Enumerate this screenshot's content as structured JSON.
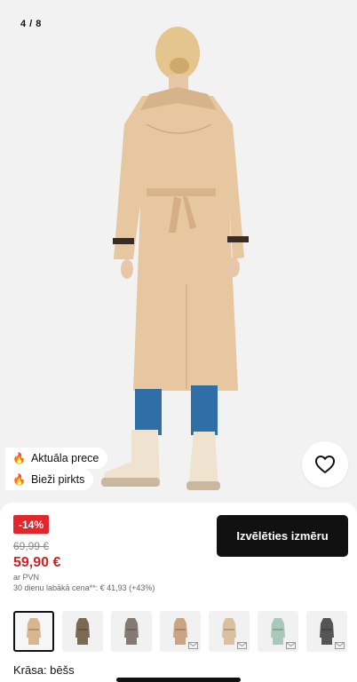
{
  "gallery": {
    "counter": "4 / 8"
  },
  "badges": [
    {
      "icon": "fire-icon",
      "label": "Aktuāla prece"
    },
    {
      "icon": "fire-icon",
      "label": "Bieži pirkts"
    }
  ],
  "favorite": {
    "icon": "heart-icon"
  },
  "price": {
    "discount": "-14%",
    "old": "69,99 €",
    "current": "59,90 €",
    "vat": "ar PVN",
    "lowest": "30 dienu labākā cena**: € 41,93 (+43%)"
  },
  "actions": {
    "choose_size": "Izvēlēties izmēru"
  },
  "swatches": [
    {
      "name": "bēšs",
      "color": "#d8b78f",
      "selected": true,
      "mail": false
    },
    {
      "name": "brūns",
      "color": "#7a6a54",
      "selected": false,
      "mail": false
    },
    {
      "name": "pelēkbrūns",
      "color": "#857a73",
      "selected": false,
      "mail": false
    },
    {
      "name": "smilškrāsa",
      "color": "#c9a582",
      "selected": false,
      "mail": true
    },
    {
      "name": "gaišbēšs",
      "color": "#d9c0a2",
      "selected": false,
      "mail": true
    },
    {
      "name": "piparmētru",
      "color": "#a9c8bc",
      "selected": false,
      "mail": true
    },
    {
      "name": "tumšpelēks",
      "color": "#555555",
      "selected": false,
      "mail": true
    }
  ],
  "color_label": "Krāsa: bēšs",
  "colors": {
    "accent_red": "#e3262b",
    "button_dark": "#111111"
  }
}
